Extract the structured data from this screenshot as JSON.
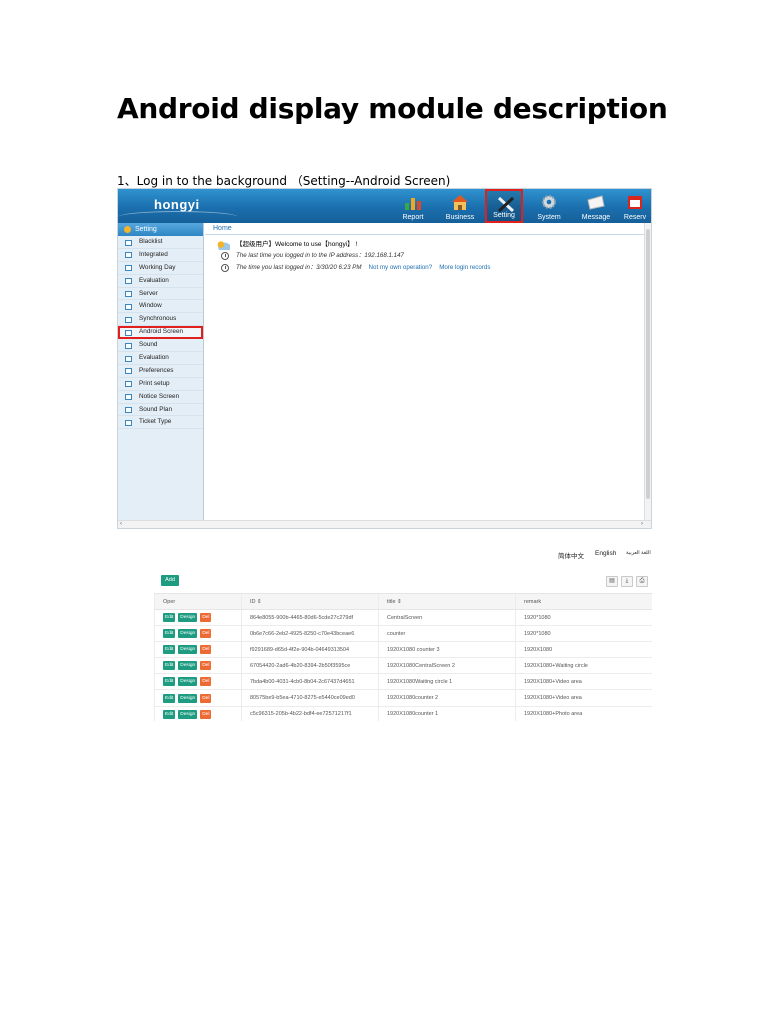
{
  "document": {
    "title": "Android display module description",
    "step1": "1、Log in to the background （Setting--Android Screen)"
  },
  "screenshot1": {
    "brand": "hongyi",
    "nav": [
      {
        "label": "Report",
        "icon": "report-icon",
        "color": "#f2a81d"
      },
      {
        "label": "Business",
        "icon": "house-icon",
        "color": "#e2581f"
      },
      {
        "label": "Setting",
        "icon": "tools-icon",
        "color": "#e8e8e8",
        "selected": true
      },
      {
        "label": "System",
        "icon": "gear-icon",
        "color": "#dfe5ea"
      },
      {
        "label": "Message",
        "icon": "envelope-icon",
        "color": "#f5f5f5"
      },
      {
        "label": "Reserv",
        "icon": "calendar-icon",
        "color": "#d8261d"
      }
    ],
    "sidebar": {
      "header": "Setting",
      "items": [
        "Blacklist",
        "Integrated",
        "Working Day",
        "Evaluation",
        "Server",
        "Window",
        "Synchronous",
        "Android Screen",
        "Sound",
        "Evaluation",
        "Preferences",
        "Print setup",
        "Notice Screen",
        "Sound Plan",
        "Ticket Type"
      ],
      "highlighted": "Android Screen"
    },
    "home_tab": "Home",
    "welcome": "【超级用户】Welcome to use【hongyi】 !",
    "last_ip": "The last time you logged in to the IP address：192.168.1.147",
    "last_time": "The time you last logged in：3/30/20 6:23 PM",
    "link_not_own": "Not my own operation?",
    "link_more": "More login records"
  },
  "languages": [
    "简体中文",
    "English",
    "اللغة العربية"
  ],
  "screenshot2": {
    "add_label": "Add",
    "columns": [
      "Oper",
      "ID ⇕",
      "title ⇕",
      "remark"
    ],
    "buttons": {
      "edit": "Edit",
      "design": "Design",
      "del": "Del"
    },
    "rows": [
      {
        "id": "864e8055-900b-4465-80d6-5cde27c279df",
        "title": "CentralScreen",
        "remark": "1920*1080"
      },
      {
        "id": "0b6e7c66-2eb2-4925-8250-c70e43bceae6",
        "title": "counter",
        "remark": "1920*1080"
      },
      {
        "id": "f9291689-d65d-4f2e-904b-04649313504",
        "title": "1920X1080 counter 3",
        "remark": "1920X1080"
      },
      {
        "id": "67054420-2ad6-4b20-8394-2b50f3595ce",
        "title": "1920X1080CentralScreen 2",
        "remark": "1920X1080+Waiting circle"
      },
      {
        "id": "7bda4b00-4031-4cb0-8b04-2c67437d4651",
        "title": "1920X1080Waiting circle 1",
        "remark": "1920X1080+Video area"
      },
      {
        "id": "80575be9-b5ea-4710-8275-e5440ce09ed0",
        "title": "1920X1080counter 2",
        "remark": "1920X1080+Video area"
      },
      {
        "id": "c5c96315-205b-4b22-bdf4-ee72571217f1",
        "title": "1920X1080counter 1",
        "remark": "1920X1080+Photo area"
      }
    ]
  }
}
